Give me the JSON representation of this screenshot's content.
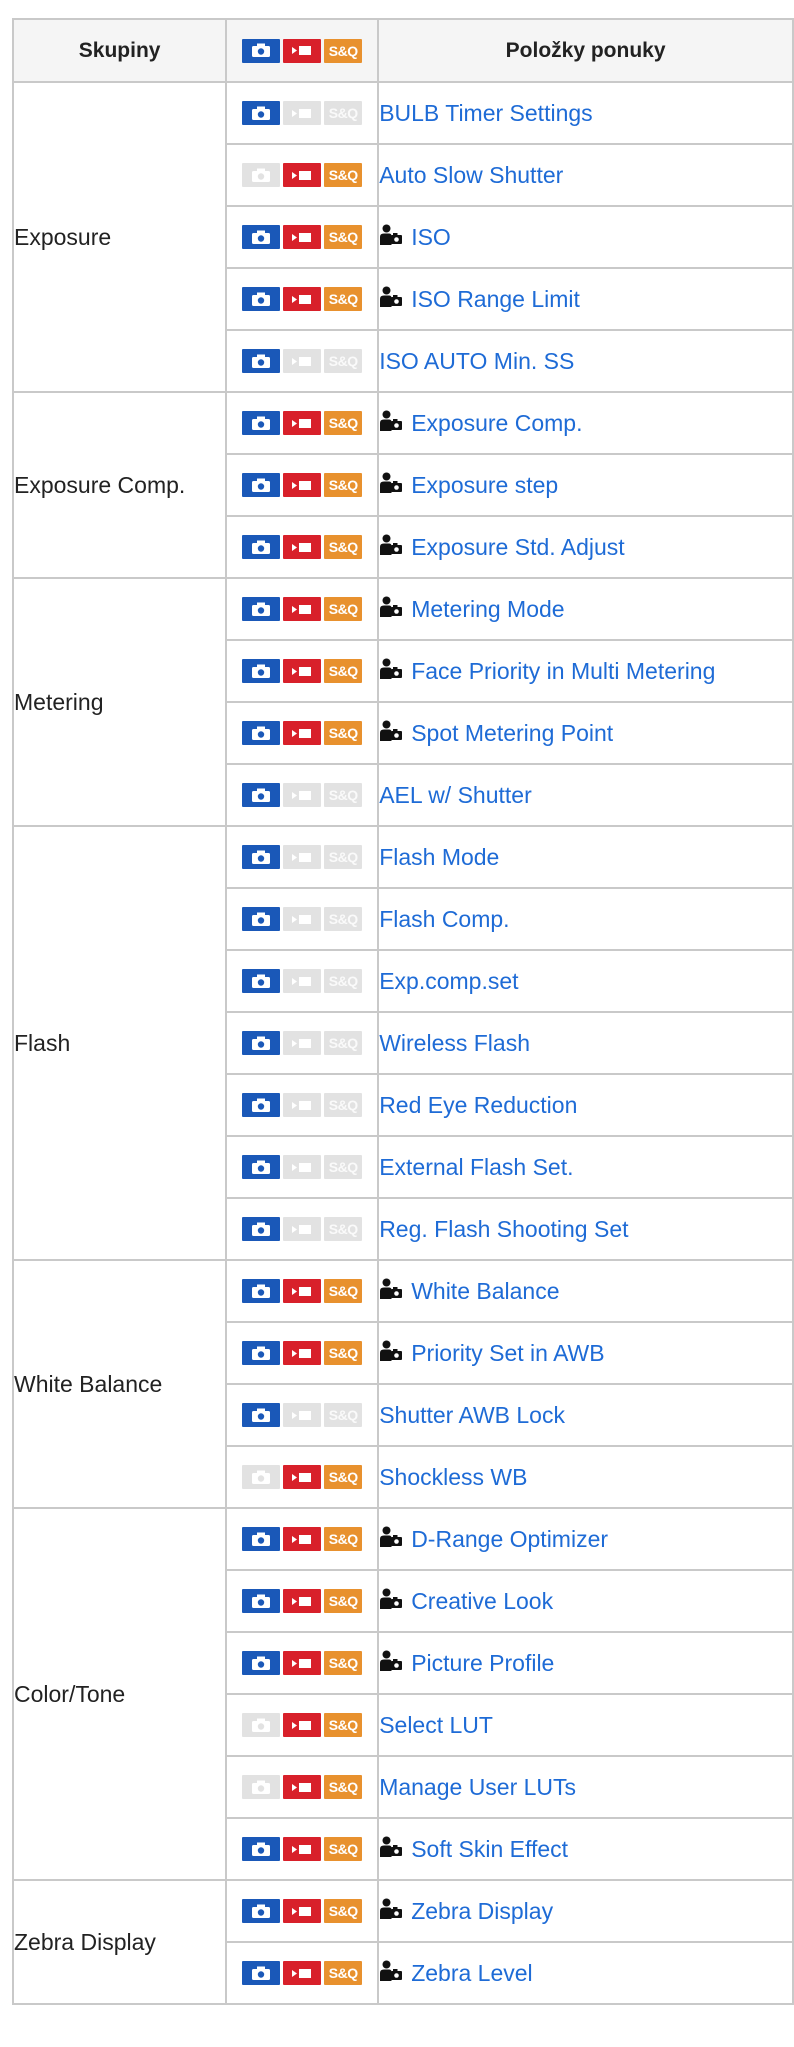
{
  "table": {
    "header": {
      "groups": "Skupiny",
      "modes_sq": "S&Q",
      "items": "Položky ponuky"
    },
    "groups": [
      {
        "name": "Exposure",
        "rows": [
          {
            "label": "BULB Timer Settings",
            "photo": true,
            "movie": false,
            "sq": false,
            "person": false
          },
          {
            "label": "Auto Slow Shutter",
            "photo": false,
            "movie": true,
            "sq": true,
            "person": false
          },
          {
            "label": "ISO",
            "photo": true,
            "movie": true,
            "sq": true,
            "person": true
          },
          {
            "label": "ISO Range Limit",
            "photo": true,
            "movie": true,
            "sq": true,
            "person": true
          },
          {
            "label": "ISO AUTO Min. SS",
            "photo": true,
            "movie": false,
            "sq": false,
            "person": false
          }
        ]
      },
      {
        "name": "Exposure Comp.",
        "rows": [
          {
            "label": "Exposure Comp.",
            "photo": true,
            "movie": true,
            "sq": true,
            "person": true
          },
          {
            "label": "Exposure step",
            "photo": true,
            "movie": true,
            "sq": true,
            "person": true
          },
          {
            "label": "Exposure Std. Adjust",
            "photo": true,
            "movie": true,
            "sq": true,
            "person": true
          }
        ]
      },
      {
        "name": "Metering",
        "rows": [
          {
            "label": "Metering Mode",
            "photo": true,
            "movie": true,
            "sq": true,
            "person": true
          },
          {
            "label": "Face Priority in Multi Metering",
            "photo": true,
            "movie": true,
            "sq": true,
            "person": true
          },
          {
            "label": "Spot Metering Point",
            "photo": true,
            "movie": true,
            "sq": true,
            "person": true
          },
          {
            "label": "AEL w/ Shutter",
            "photo": true,
            "movie": false,
            "sq": false,
            "person": false
          }
        ]
      },
      {
        "name": "Flash",
        "rows": [
          {
            "label": "Flash Mode",
            "photo": true,
            "movie": false,
            "sq": false,
            "person": false
          },
          {
            "label": "Flash Comp.",
            "photo": true,
            "movie": false,
            "sq": false,
            "person": false
          },
          {
            "label": "Exp.comp.set",
            "photo": true,
            "movie": false,
            "sq": false,
            "person": false
          },
          {
            "label": "Wireless Flash",
            "photo": true,
            "movie": false,
            "sq": false,
            "person": false
          },
          {
            "label": "Red Eye Reduction",
            "photo": true,
            "movie": false,
            "sq": false,
            "person": false
          },
          {
            "label": "External Flash Set.",
            "photo": true,
            "movie": false,
            "sq": false,
            "person": false
          },
          {
            "label": "Reg. Flash Shooting Set",
            "photo": true,
            "movie": false,
            "sq": false,
            "person": false
          }
        ]
      },
      {
        "name": "White Balance",
        "rows": [
          {
            "label": "White Balance",
            "photo": true,
            "movie": true,
            "sq": true,
            "person": true
          },
          {
            "label": "Priority Set in AWB",
            "photo": true,
            "movie": true,
            "sq": true,
            "person": true
          },
          {
            "label": "Shutter AWB Lock",
            "photo": true,
            "movie": false,
            "sq": false,
            "person": false
          },
          {
            "label": "Shockless WB",
            "photo": false,
            "movie": true,
            "sq": true,
            "person": false
          }
        ]
      },
      {
        "name": "Color/Tone",
        "rows": [
          {
            "label": "D-Range Optimizer",
            "photo": true,
            "movie": true,
            "sq": true,
            "person": true
          },
          {
            "label": "Creative Look",
            "photo": true,
            "movie": true,
            "sq": true,
            "person": true
          },
          {
            "label": "Picture Profile",
            "photo": true,
            "movie": true,
            "sq": true,
            "person": true
          },
          {
            "label": "Select LUT",
            "photo": false,
            "movie": true,
            "sq": true,
            "person": false
          },
          {
            "label": "Manage User LUTs",
            "photo": false,
            "movie": true,
            "sq": true,
            "person": false
          },
          {
            "label": "Soft Skin Effect",
            "photo": true,
            "movie": true,
            "sq": true,
            "person": true
          }
        ]
      },
      {
        "name": "Zebra Display",
        "rows": [
          {
            "label": "Zebra Display",
            "photo": true,
            "movie": true,
            "sq": true,
            "person": true
          },
          {
            "label": "Zebra Level",
            "photo": true,
            "movie": true,
            "sq": true,
            "person": true
          }
        ]
      }
    ]
  },
  "colors": {
    "photo": "#1a58b8",
    "movie": "#d8202a",
    "sq": "#e8912e",
    "off": "#e2e2e2",
    "link": "#1e6bd6",
    "border": "#c9c9c9"
  },
  "icons": {
    "photo": "camera-icon",
    "movie": "movie-icon",
    "sq": "sq-icon",
    "person": "person-camera-icon"
  }
}
